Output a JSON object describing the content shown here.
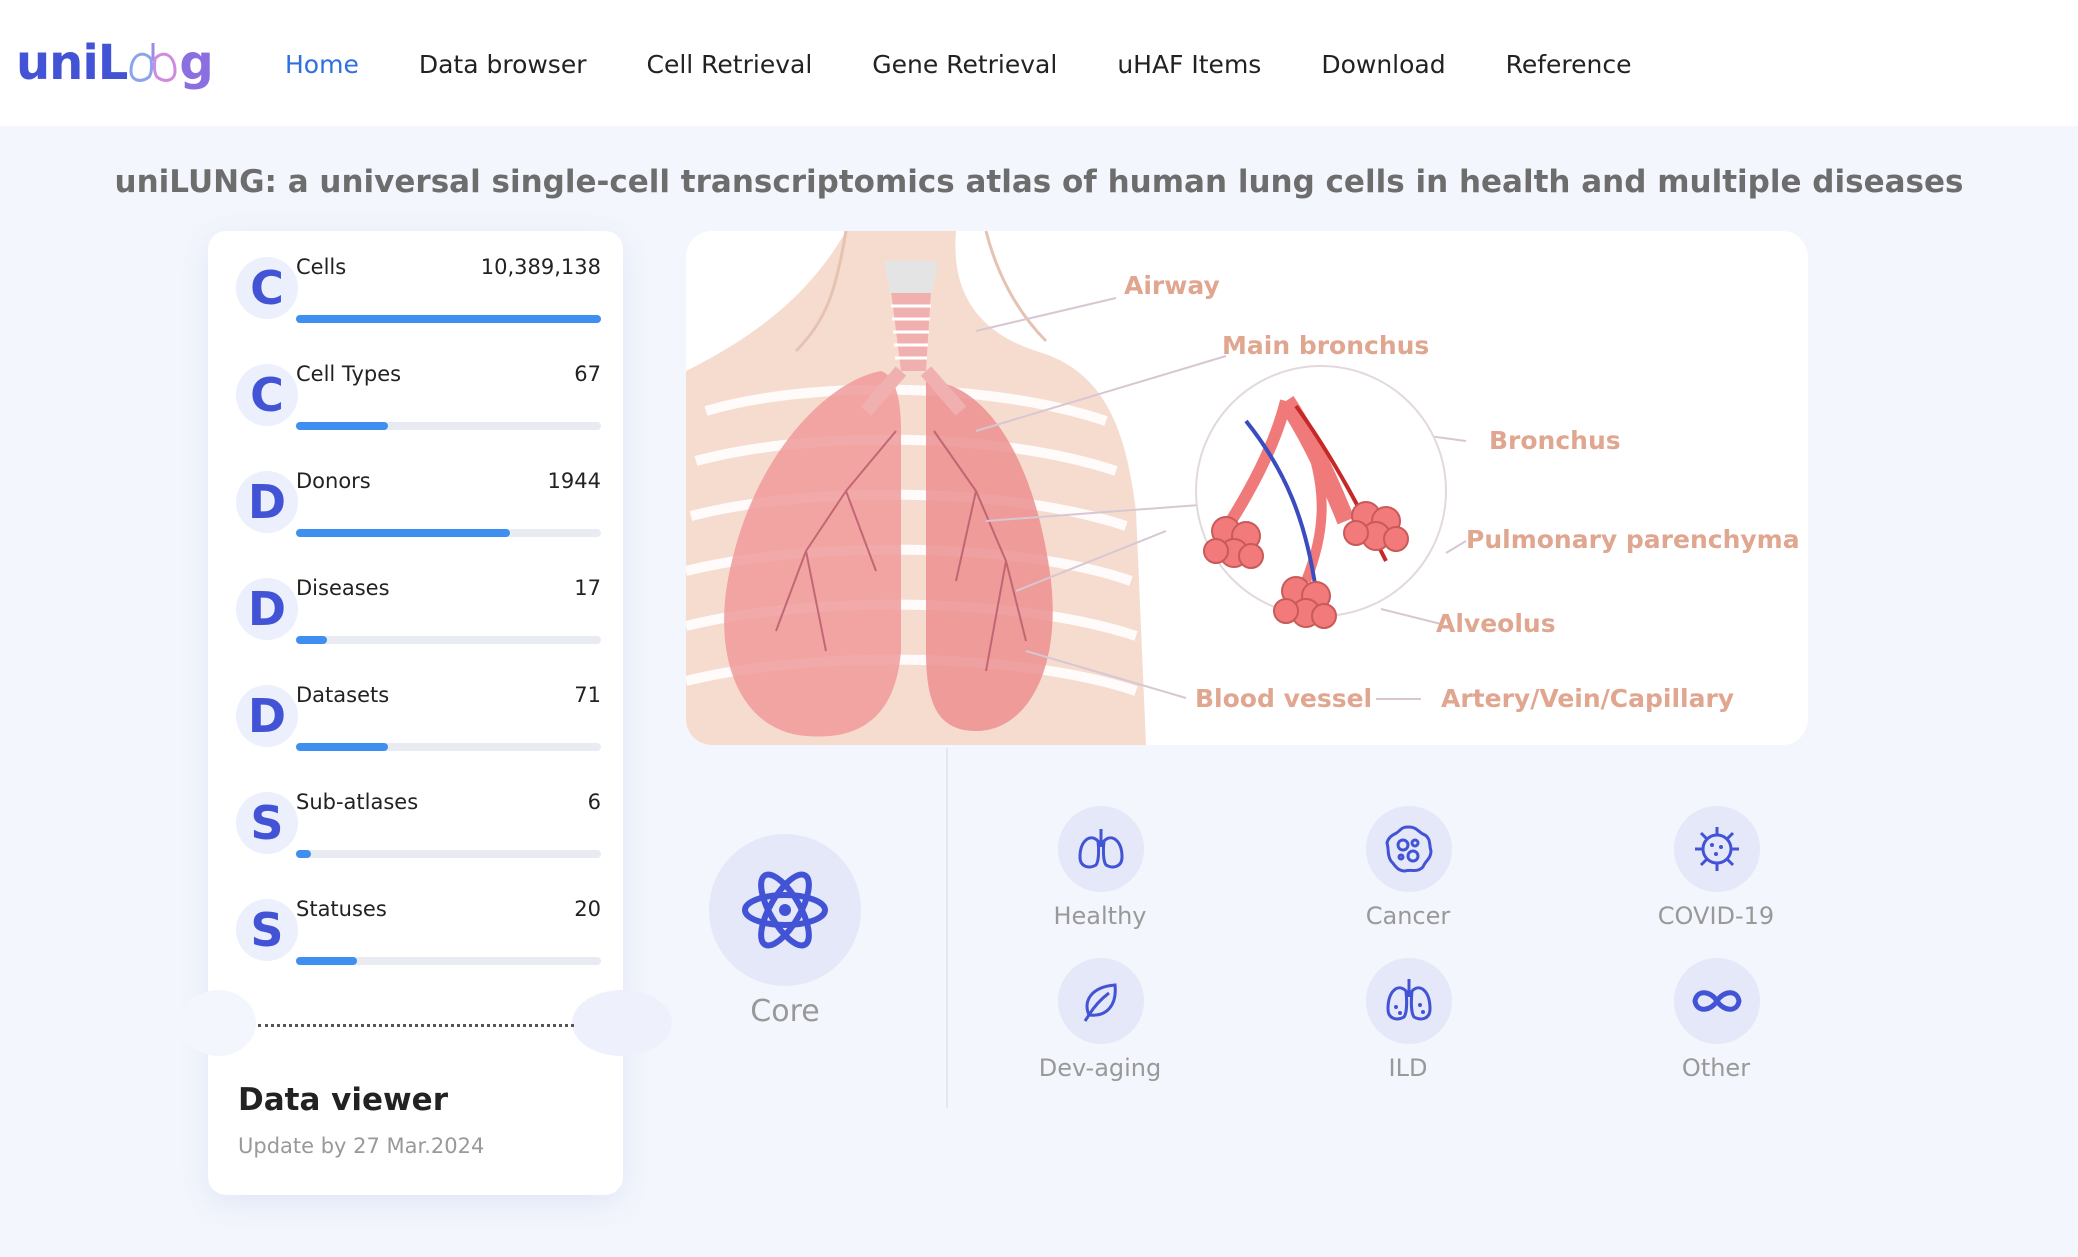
{
  "brand": {
    "part1": "uniL",
    "part2": "g"
  },
  "nav": [
    {
      "label": "Home",
      "active": true
    },
    {
      "label": "Data browser"
    },
    {
      "label": "Cell Retrieval"
    },
    {
      "label": "Gene Retrieval"
    },
    {
      "label": "uHAF Items"
    },
    {
      "label": "Download"
    },
    {
      "label": "Reference"
    }
  ],
  "title": "uniLUNG: a universal single-cell transcriptomics atlas of human lung cells in health and multiple diseases",
  "stats": [
    {
      "letter": "C",
      "label": "Cells",
      "value": "10,389,138",
      "fill": 1.0
    },
    {
      "letter": "C",
      "label": "Cell Types",
      "value": "67",
      "fill": 0.3
    },
    {
      "letter": "D",
      "label": "Donors",
      "value": "1944",
      "fill": 0.7
    },
    {
      "letter": "D",
      "label": "Diseases",
      "value": "17",
      "fill": 0.1
    },
    {
      "letter": "D",
      "label": "Datasets",
      "value": "71",
      "fill": 0.3
    },
    {
      "letter": "S",
      "label": "Sub-atlases",
      "value": "6",
      "fill": 0.05
    },
    {
      "letter": "S",
      "label": "Statuses",
      "value": "20",
      "fill": 0.2
    }
  ],
  "viewer": {
    "title": "Data viewer",
    "update": "Update by 27 Mar.2024"
  },
  "illustration": {
    "labels": {
      "airway": "Airway",
      "main_bronchus": "Main bronchus",
      "bronchus": "Bronchus",
      "parenchyma": "Pulmonary parenchyma",
      "alveolus": "Alveolus",
      "blood_vessel": "Blood vessel",
      "avc": "Artery/Vein/Capillary"
    }
  },
  "core": {
    "label": "Core",
    "icon": "atom-icon"
  },
  "categories": [
    {
      "label": "Healthy",
      "icon": "lungs-icon"
    },
    {
      "label": "Cancer",
      "icon": "cancer-cell-icon"
    },
    {
      "label": "COVID-19",
      "icon": "virus-icon"
    },
    {
      "label": "Dev-aging",
      "icon": "leaf-icon"
    },
    {
      "label": "ILD",
      "icon": "diseased-lungs-icon"
    },
    {
      "label": "Other",
      "icon": "infinity-icon"
    }
  ],
  "colors": {
    "accent": "#4353d6",
    "link_active": "#2f6fe0",
    "bar": "#3e8ff0",
    "label_peach": "#e0a690"
  }
}
